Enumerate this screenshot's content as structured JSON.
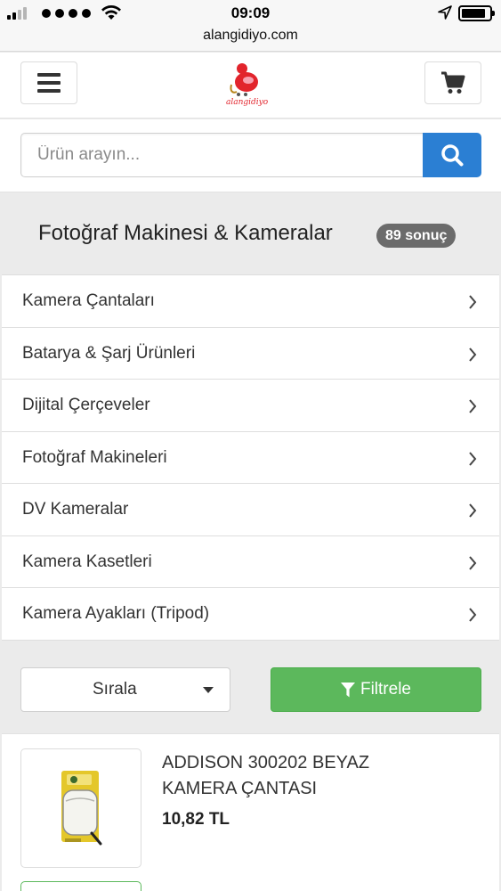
{
  "status_bar": {
    "time": "09:09",
    "url": "alangidiyo.com"
  },
  "header": {
    "logo_text": "alangidiyo",
    "brand_color": "#e2242c"
  },
  "search": {
    "placeholder": "Ürün arayın...",
    "button_color": "#2b7fd3"
  },
  "category": {
    "title": "Fotoğraf Makinesi & Kameralar",
    "count_badge": "89 sonuç"
  },
  "subcategories": [
    {
      "label": "Kamera Çantaları"
    },
    {
      "label": "Batarya & Şarj Ürünleri"
    },
    {
      "label": "Dijital Çerçeveler"
    },
    {
      "label": "Fotoğraf Makineleri"
    },
    {
      "label": "DV Kameralar"
    },
    {
      "label": "Kamera Kasetleri"
    },
    {
      "label": "Kamera Ayakları (Tripod)"
    }
  ],
  "toolbar": {
    "sort_label": "Sırala",
    "filter_label": "Filtrele",
    "filter_color": "#5cb85c"
  },
  "products": [
    {
      "name": "ADDISON 300202 BEYAZ KAMERA ÇANTASI",
      "price": "10,82 TL",
      "image_icon": "camera-bag-image"
    }
  ]
}
